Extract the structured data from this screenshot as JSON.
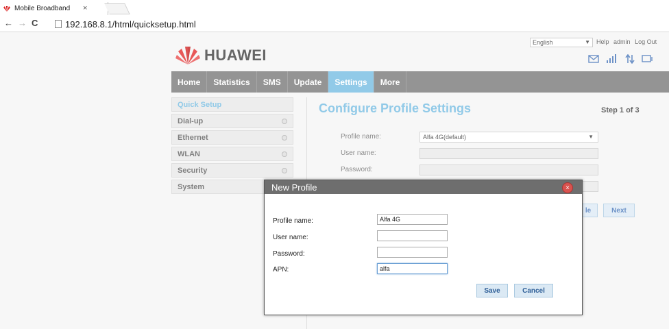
{
  "browser": {
    "tab_title": "Mobile Broadband",
    "tab_close": "×",
    "url": "192.168.8.1/html/quicksetup.html",
    "back": "←",
    "forward": "→",
    "reload": "C"
  },
  "header": {
    "language": "English",
    "links": [
      "Help",
      "admin",
      "Log Out"
    ],
    "brand": "HUAWEI",
    "icons": [
      "mail-icon",
      "signal-icon",
      "data-transfer-icon",
      "connection-icon"
    ]
  },
  "nav": {
    "items": [
      "Home",
      "Statistics",
      "SMS",
      "Update",
      "Settings",
      "More"
    ],
    "active": "Settings"
  },
  "sidebar": {
    "items": [
      {
        "label": "Quick Setup",
        "active": true
      },
      {
        "label": "Dial-up"
      },
      {
        "label": "Ethernet"
      },
      {
        "label": "WLAN"
      },
      {
        "label": "Security"
      },
      {
        "label": "System"
      }
    ]
  },
  "main": {
    "title": "Configure Profile Settings",
    "step": "Step 1 of 3",
    "fields": {
      "profile_name_label": "Profile name:",
      "profile_name_value": "Alfa 4G(default)",
      "user_name_label": "User name:",
      "password_label": "Password:"
    },
    "buttons": {
      "partial_label": "le",
      "next_label": "Next"
    }
  },
  "modal": {
    "title": "New Profile",
    "profile_name_label": "Profile name:",
    "profile_name_value": "Alfa 4G",
    "user_name_label": "User name:",
    "user_name_value": "",
    "password_label": "Password:",
    "password_value": "",
    "apn_label": "APN:",
    "apn_value": "alfa",
    "save_label": "Save",
    "cancel_label": "Cancel",
    "close_glyph": "×"
  },
  "colors": {
    "accent": "#6cb8e0",
    "nav_bg": "#707070",
    "brand_red": "#e02020"
  }
}
